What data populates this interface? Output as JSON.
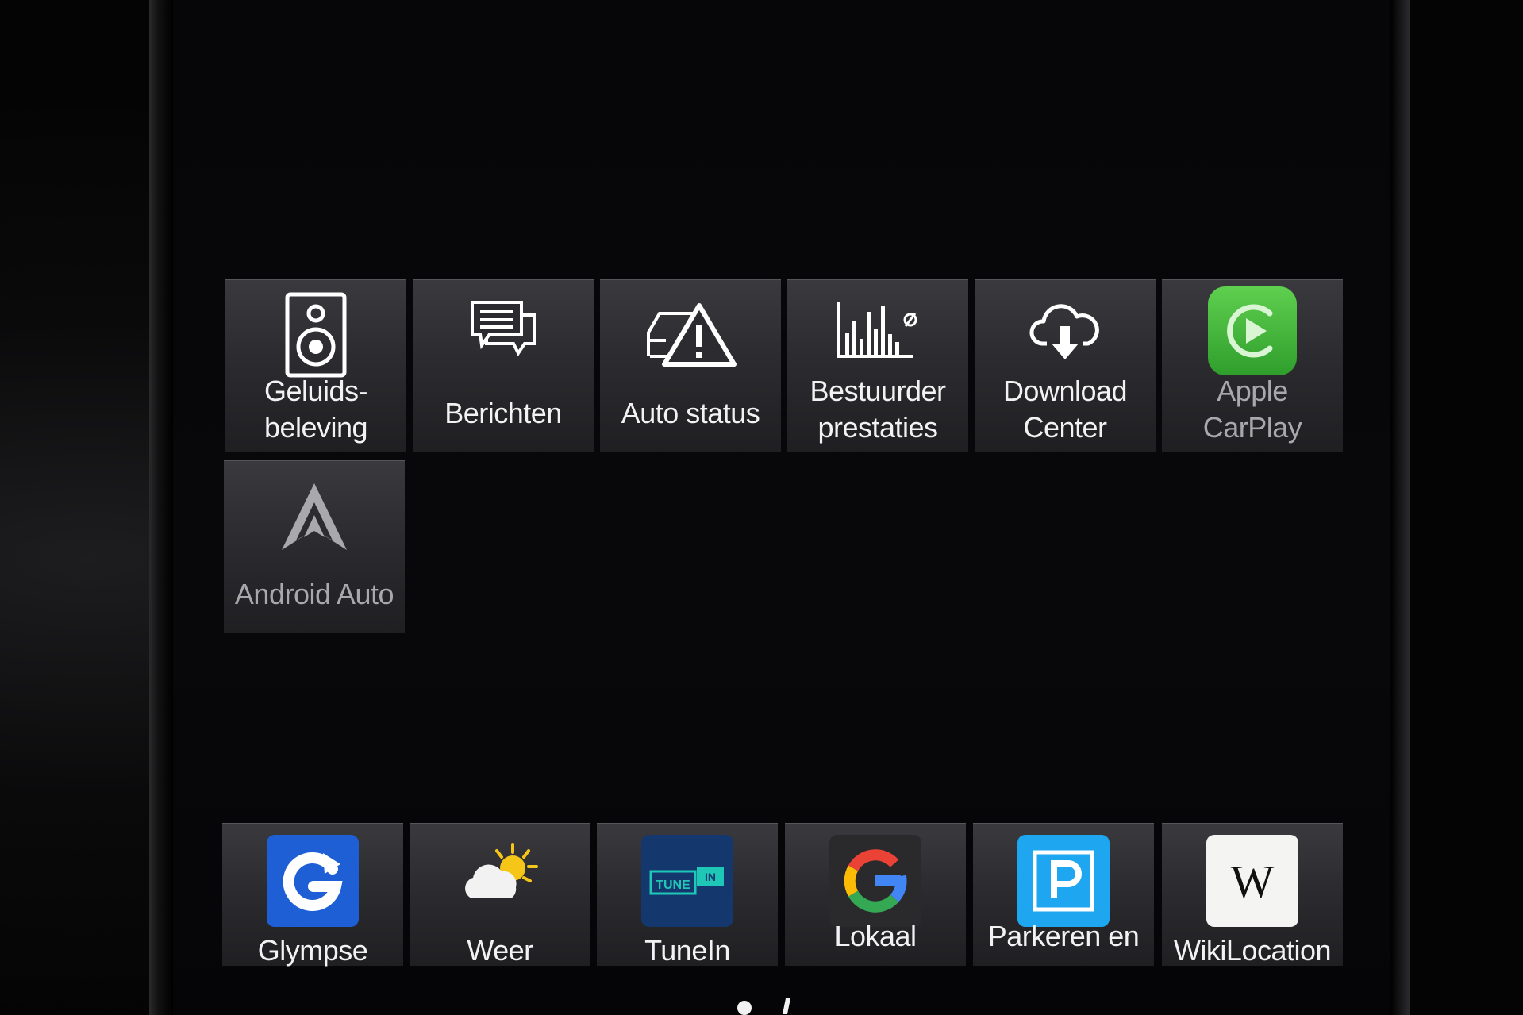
{
  "screen": {
    "top_row_apps": [
      {
        "label": "Geluids-\nbeleving",
        "icon": "speaker-icon"
      },
      {
        "label": "Berichten",
        "icon": "messages-icon"
      },
      {
        "label": "Auto status",
        "icon": "car-warning-icon"
      },
      {
        "label": "Bestuurder\nprestaties",
        "icon": "driver-stats-icon"
      },
      {
        "label": "Download\nCenter",
        "icon": "cloud-download-icon"
      },
      {
        "label": "Apple\nCarPlay",
        "icon": "carplay-icon"
      }
    ],
    "second_row_apps": [
      {
        "label": "Android Auto",
        "icon": "android-auto-icon"
      }
    ],
    "bottom_row_apps": [
      {
        "label": "Glympse",
        "icon": "glympse-icon"
      },
      {
        "label": "Weer",
        "icon": "weather-icon"
      },
      {
        "label": "TuneIn",
        "icon": "tunein-icon"
      },
      {
        "label": "Lokaal",
        "icon": "google-icon"
      },
      {
        "label": "Parkeren en",
        "icon": "parking-icon"
      },
      {
        "label": "WikiLocation",
        "icon": "wikipedia-icon"
      }
    ],
    "colors": {
      "carplay_green": "#3fae3a",
      "glympse_blue": "#1f5fd6",
      "tunein_navy": "#14376e",
      "tunein_teal": "#1fc7b7",
      "parking_blue": "#1ea6f0"
    }
  }
}
